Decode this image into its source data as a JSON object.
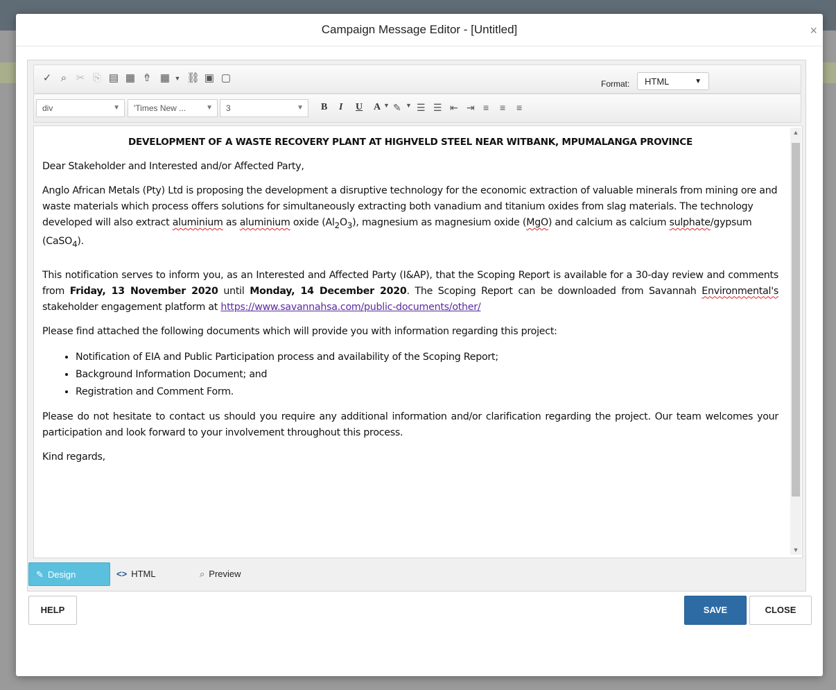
{
  "modal": {
    "title": "Campaign Message Editor - [Untitled]",
    "close_glyph": "×"
  },
  "toolbar": {
    "format_label": "Format:",
    "format_value": "HTML",
    "block_value": "div",
    "font_value": "'Times New ...",
    "size_value": "3",
    "bold": "B",
    "italic": "I",
    "underline": "U",
    "font_color": "A"
  },
  "document": {
    "heading": "DEVELOPMENT OF A WASTE RECOVERY PLANT AT HIGHVELD STEEL NEAR WITBANK, MPUMALANGA PROVINCE",
    "salutation": "Dear Stakeholder and Interested and/or Affected Party,",
    "p1_a": "Anglo African Metals (Pty) Ltd is proposing the development a disruptive technology for the economic extraction of valuable minerals from mining ore and waste materials which process offers solutions for simultaneously extracting both vanadium and titanium oxides from slag materials.  The technology developed will also extract ",
    "p1_aluminium1": "aluminium",
    "p1_b": " as ",
    "p1_aluminium2": "aluminium",
    "p1_c": " oxide (Al",
    "p1_sub2": "2",
    "p1_d": "O",
    "p1_sub3": "3",
    "p1_e": "), magnesium as magnesium oxide (",
    "p1_mgo": "MgO",
    "p1_f": ") and calcium as calcium ",
    "p1_sulphate": "sulphate",
    "p1_g": "/gypsum (CaSO",
    "p1_sub4": "4",
    "p1_h": ").",
    "p2_a": "This notification serves to inform you, as an Interested and Affected Party (I&AP), that the Scoping Report is available for a 30-day review and comments from ",
    "p2_date1": "Friday, 13 November 2020",
    "p2_b": " until ",
    "p2_date2": "Monday, 14 December 2020",
    "p2_c": ".  The Scoping Report can be downloaded from Savannah ",
    "p2_env": "Environmental's",
    "p2_d": " stakeholder engagement platform at ",
    "p2_link": "https://www.savannahsa.com/public-documents/other/",
    "p3": "Please find attached the following documents which will provide you with information regarding this project:",
    "bullets": [
      "Notification of EIA and Public Participation process and availability of the Scoping Report;",
      "Background Information Document; and",
      "Registration and Comment Form."
    ],
    "p4": "Please do not hesitate to contact us should you require any additional information and/or clarification regarding the project. Our team welcomes your participation and look forward to your involvement throughout this process.",
    "closing": "Kind regards,"
  },
  "tabs": {
    "design": "Design",
    "html": "HTML",
    "preview": "Preview"
  },
  "buttons": {
    "help": "HELP",
    "save": "SAVE",
    "close": "CLOSE"
  }
}
